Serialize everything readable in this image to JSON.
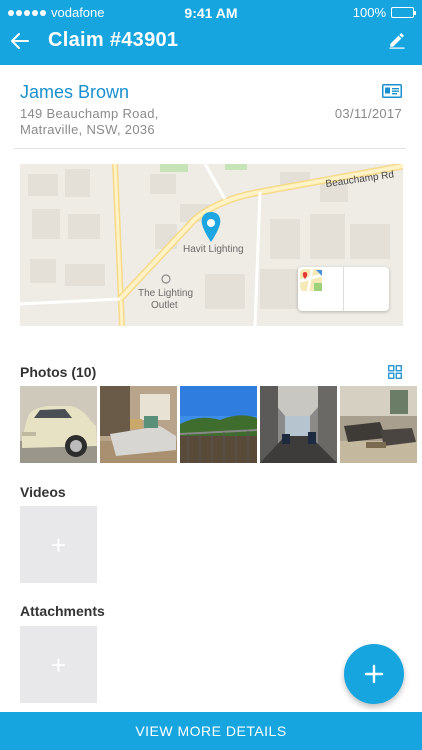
{
  "status_bar": {
    "carrier": "vodafone",
    "time": "9:41 AM",
    "battery": "100%"
  },
  "header": {
    "title": "Claim #43901",
    "back_icon": "arrow-left-icon",
    "edit_icon": "pencil-icon"
  },
  "claim": {
    "name": "James Brown",
    "address_line1": "149 Beauchamp Road,",
    "address_line2": "Matraville, NSW, 2036",
    "date": "03/11/2017"
  },
  "map": {
    "road_label": "Beauchamp Rd",
    "place_labels": [
      "Havit Lighting",
      "The Lighting",
      "Outlet"
    ],
    "directions_icon": "directions-icon",
    "maps_app_icon": "maps-app-icon"
  },
  "photos": {
    "title": "Photos (10)"
  },
  "videos": {
    "title": "Videos",
    "add_icon": "plus-icon"
  },
  "attachments": {
    "title": "Attachments",
    "add_icon": "plus-icon"
  },
  "fab": {
    "icon": "plus-icon"
  },
  "footer": {
    "button_label": "VIEW MORE DETAILS"
  },
  "colors": {
    "primary": "#17a5e0",
    "name_text": "#1a8fcf",
    "muted_text": "#8a8a8a",
    "placeholder_tile": "#e8e8ea"
  }
}
